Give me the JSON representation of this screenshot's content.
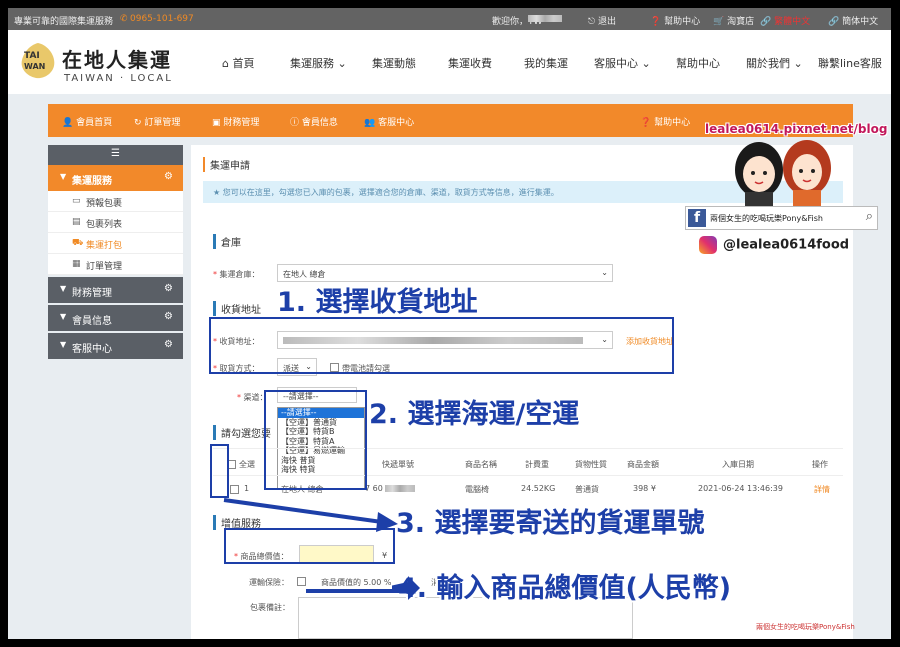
{
  "topbar": {
    "slogan": "專業可靠的國際集運服務",
    "phone": "0965-101-697",
    "welcome": "歡迎你，TW",
    "logout": "退出",
    "help": "幫助中心",
    "taobao": "淘寶店",
    "lang_active": "繁體中文",
    "lang_alt": "簡体中文"
  },
  "header": {
    "logo_mark": "TAI WAN",
    "logo_cn": "在地人集運",
    "logo_en": "TAIWAN · LOCAL",
    "nav": [
      "首頁",
      "集運服務",
      "集運動態",
      "集運收費",
      "我的集運",
      "客服中心",
      "幫助中心",
      "關於我們",
      "聯繫line客服"
    ]
  },
  "subbar": {
    "items": [
      "會員首頁",
      "訂單管理",
      "財務管理",
      "會員信息",
      "客服中心"
    ],
    "help": "幫助中心"
  },
  "sidebar": {
    "menu_icon": "☰",
    "groups": [
      {
        "label": "集運服務",
        "children": [
          "預報包裹",
          "包裹列表",
          "集運打包",
          "訂單管理"
        ]
      },
      {
        "label": "財務管理"
      },
      {
        "label": "會員信息"
      },
      {
        "label": "客服中心"
      }
    ]
  },
  "main": {
    "title": "集運申請",
    "hint": "您可以在這里，勾選您已入庫的包裹，選擇適合您的倉庫、渠道，取貨方式等信息，進行集運。",
    "warehouse_section": "倉庫",
    "warehouse_label": "集運倉庫：",
    "warehouse_value": "在地人 總倉",
    "receive_section": "收貨地址",
    "address_label": "收貨地址：",
    "add_address": "添加收貨地址",
    "pickup_label": "取貨方式：",
    "pickup_value": "派送",
    "pickup_check": "帶電池請勾選",
    "channel_label": "渠道：",
    "channel_value": "--請選擇--",
    "channel_options": [
      "--請選擇--",
      "【空運】普通貨",
      "【空運】特貨B",
      "【空運】特貨A",
      "【空運】易燃運輸",
      "海快 普貨",
      "海快 特貨"
    ],
    "select_section": "請勾選您要",
    "table_headers": [
      "全選",
      "快遞單號",
      "商品名稱",
      "計費重",
      "貨物性質",
      "商品金額",
      "入庫日期",
      "操作"
    ],
    "table_rows": [
      {
        "index": "1",
        "warehouse": "在地人 總倉",
        "tracking": "7 60",
        "name": "電腦椅",
        "weight": "24.52KG",
        "nature": "普通貨",
        "amount": "398 ¥",
        "date": "2021-06-24 13:46:39",
        "action": "詳情"
      }
    ],
    "value_section": "增值服務",
    "goods_value_label": "商品總價值：",
    "currency": "¥",
    "insurance_label": "運輸保險：",
    "insurance_text": "商品價值的 5.00 %",
    "consume_label": "消費",
    "remark_label": "包裹備註："
  },
  "annotations": {
    "step1": "1. 選擇收貨地址",
    "step2": "2. 選擇海運/空運",
    "step3": "3. 選擇要寄送的貨運單號",
    "step4": "4. 輸入商品總價值(人民幣)",
    "color": "#1d3fa8"
  },
  "watermark": {
    "blog": "lealea0614.pixnet.net/blog",
    "fb_text": "兩個女生的吃喝玩樂Pony&Fish",
    "ig": "@lealea0614food",
    "signature": "兩個女生的吃喝玩樂Pony&Fish"
  }
}
